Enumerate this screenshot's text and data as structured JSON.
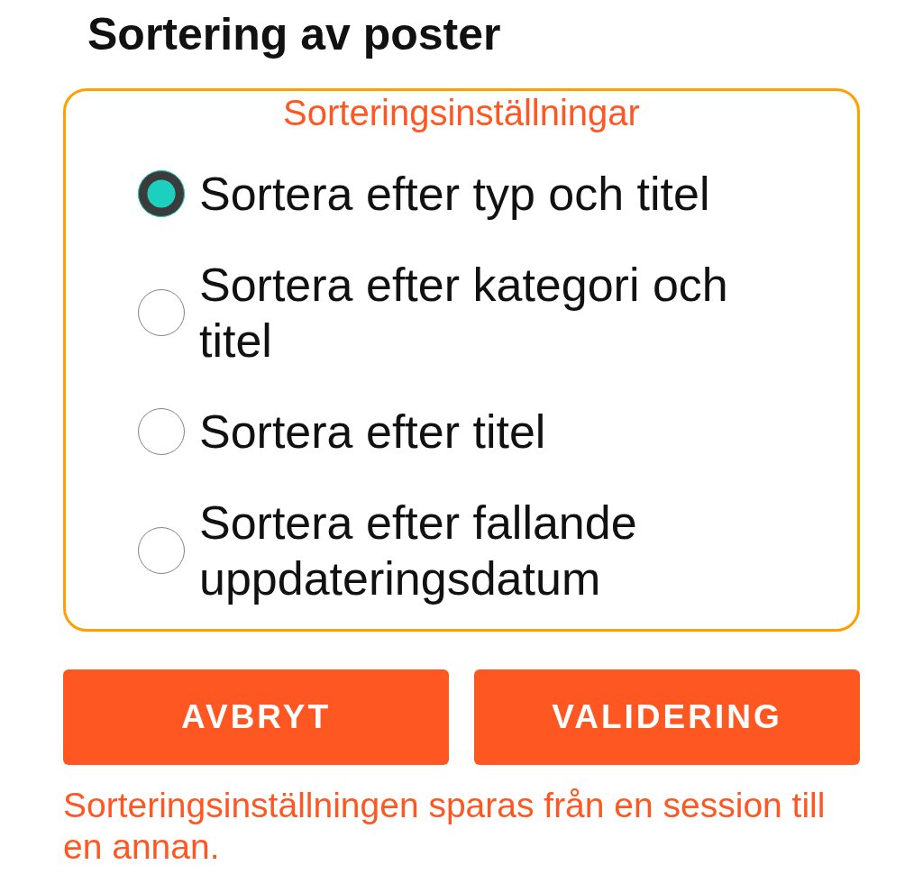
{
  "title": "Sortering av poster",
  "group": {
    "legend": "Sorteringsinställningar",
    "options": [
      {
        "label": "Sortera efter typ och titel",
        "selected": true
      },
      {
        "label": "Sortera efter kategori och titel",
        "selected": false
      },
      {
        "label": "Sortera efter titel",
        "selected": false
      },
      {
        "label": "Sortera efter fallande uppdateringsdatum",
        "selected": false
      }
    ]
  },
  "buttons": [
    "AVBRYT",
    "VALIDERING"
  ],
  "note": "Sorteringsinställningen sparas från en session till en annan."
}
